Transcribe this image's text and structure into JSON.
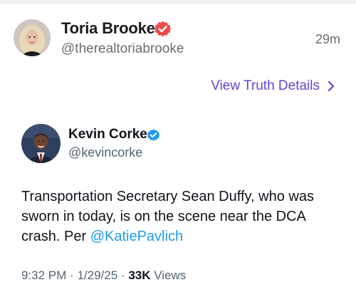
{
  "post": {
    "author_name": "Toria Brooke",
    "author_handle": "@therealtoriabrooke",
    "time_ago": "29m",
    "view_details_label": "View Truth Details",
    "icons": {
      "verified": "verified-badge-icon",
      "chevron": "chevron-right-icon"
    },
    "colors": {
      "verified_badge": "#e94d4a",
      "link": "#5c47d1"
    }
  },
  "embedded": {
    "author_name": "Kevin Corke",
    "author_handle": "@kevincorke",
    "text_before": "Transportation Secretary Sean Duffy, who was sworn in today, is on the scene near the DCA crash. Per ",
    "mention": "@KatiePavlich",
    "time": "9:32 PM",
    "date": "1/29/25",
    "views_count": "33K",
    "views_label": "Views",
    "separator": "·",
    "colors": {
      "verified_badge": "#1d9bf0",
      "mention": "#1d9bf0"
    }
  }
}
